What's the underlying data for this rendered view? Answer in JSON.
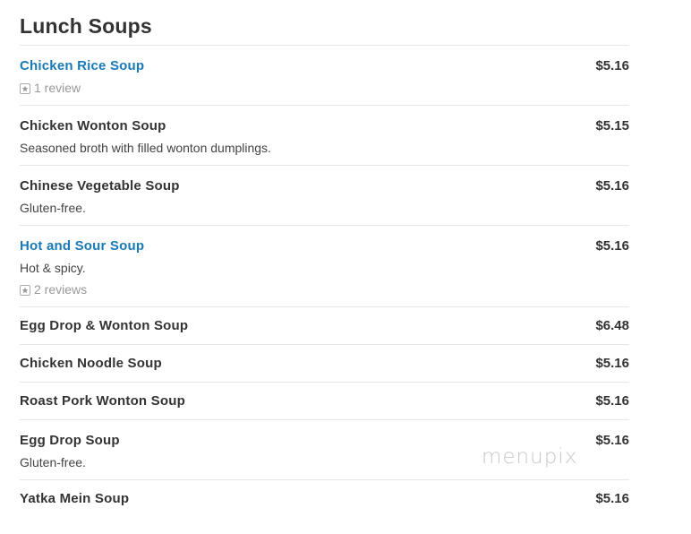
{
  "section": {
    "title": "Lunch Soups"
  },
  "items": [
    {
      "name": "Chicken Rice Soup",
      "price": "$5.16",
      "description": "",
      "reviews": "1 review"
    },
    {
      "name": "Chicken Wonton Soup",
      "price": "$5.15",
      "description": "Seasoned broth with filled wonton dumplings.",
      "reviews": ""
    },
    {
      "name": "Chinese Vegetable Soup",
      "price": "$5.16",
      "description": "Gluten-free.",
      "reviews": ""
    },
    {
      "name": "Hot and Sour Soup",
      "price": "$5.16",
      "description": "Hot & spicy.",
      "reviews": "2 reviews"
    },
    {
      "name": "Egg Drop & Wonton Soup",
      "price": "$6.48",
      "description": "",
      "reviews": ""
    },
    {
      "name": "Chicken Noodle Soup",
      "price": "$5.16",
      "description": "",
      "reviews": ""
    },
    {
      "name": "Roast Pork Wonton Soup",
      "price": "$5.16",
      "description": "",
      "reviews": ""
    },
    {
      "name": "Egg Drop Soup",
      "price": "$5.16",
      "description": "Gluten-free.",
      "reviews": ""
    },
    {
      "name": "Yatka Mein Soup",
      "price": "$5.16",
      "description": "",
      "reviews": ""
    }
  ],
  "watermark": "menupix",
  "colors": {
    "link": "#1a7ab5",
    "text": "#333333",
    "muted": "#999999",
    "divider": "#e6e6e6"
  },
  "icons": {
    "review": "star-review-icon"
  }
}
